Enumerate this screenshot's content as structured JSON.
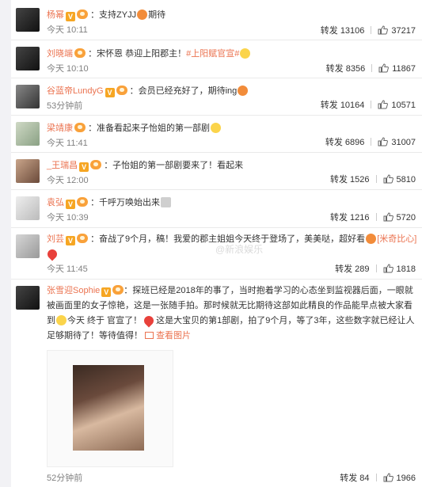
{
  "comments": [
    {
      "user": "杨幂",
      "text_parts": [
        "：支持ZYJJ",
        "",
        "期待"
      ],
      "time": "今天 10:11",
      "reposts_label": "转发",
      "reposts": "13106",
      "likes": "37217",
      "avatar": "av-dark"
    },
    {
      "user": "刘晓端",
      "text_parts": [
        "：宋怀恩 恭迎上阳郡主！",
        "#上阳赋官宣#",
        ""
      ],
      "time": "今天 10:10",
      "reposts_label": "转发",
      "reposts": "8356",
      "likes": "11867",
      "avatar": "av-dark"
    },
    {
      "user": "谷蓝帝LundyG",
      "text_parts": [
        "：会员已经充好了，期待ing",
        ""
      ],
      "time": "53分钟前",
      "reposts_label": "转发",
      "reposts": "10164",
      "likes": "10571",
      "avatar": "av-mid"
    },
    {
      "user": "梁靖康",
      "text_parts": [
        "：准备看起来子怡姐的第一部剧",
        ""
      ],
      "time": "今天 11:41",
      "reposts_label": "转发",
      "reposts": "6896",
      "likes": "31007",
      "avatar": "av-teal"
    },
    {
      "user": "_王瑞昌",
      "text_parts": [
        "：子怡姐的第一部剧要来了！看起来"
      ],
      "time": "今天 12:00",
      "reposts_label": "转发",
      "reposts": "1526",
      "likes": "5810",
      "avatar": "av-warm"
    },
    {
      "user": "袁弘",
      "text_parts": [
        "：千呼万唤始出来",
        ""
      ],
      "time": "今天 10:39",
      "reposts_label": "转发",
      "reposts": "1216",
      "likes": "5720",
      "avatar": "av-light"
    },
    {
      "user": "刘芸",
      "text_parts": [
        "：奋战了9个月，稿！我爱的郡主姐姐今天终于登场了，美美哒，超好看",
        "[米奇比心]"
      ],
      "time": "今天 11:45",
      "reposts_label": "转发",
      "reposts": "289",
      "likes": "1818",
      "avatar": "av-gray"
    },
    {
      "user": "张雪迎Sophie",
      "text_parts": [
        "：探班已经是2018年的事了，当时抱着学习的心态坐到监视器后面，一眼就被画面里的女子惊艳，这是一张随手拍。那时候就无比期待这部如此精良的作品能早点被大家看到",
        "今天 终于 官宣了！",
        "这是大宝贝的第1部剧，拍了9个月，等了3年，这些数字就已经让人足够期待了！等待值得！"
      ],
      "img_link": "查看图片",
      "time": "52分钟前",
      "reposts_label": "转发",
      "reposts": "84",
      "likes": "1966",
      "avatar": "av-dark"
    }
  ],
  "watermark": "@新浪娱乐"
}
